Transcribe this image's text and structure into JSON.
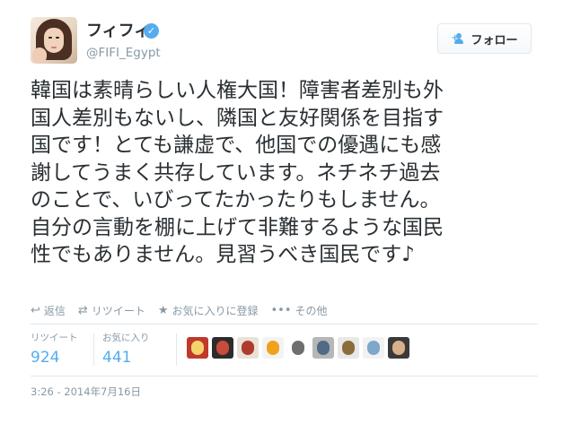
{
  "user": {
    "display_name": "フィフィ",
    "handle": "@FIFI_Egypt",
    "verified_glyph": "✓"
  },
  "follow_button": {
    "label": "フォロー"
  },
  "tweet": {
    "lines": [
      "韓国は素晴らしい人権大国！障害者差別も外",
      "国人差別もないし、隣国と友好関係を目指す",
      "国です！とても謙虚で、他国での優遇にも感",
      "謝してうまく共存しています。ネチネチ過去",
      "のことで、いびってたかったりもしません。",
      "自分の言動を棚に上げて非難するような国民",
      "性でもありません。見習うべき国民です♪"
    ]
  },
  "actions": {
    "reply": "返信",
    "retweet": "リツイート",
    "favorite": "お気に入りに登録",
    "more": "その他"
  },
  "stats": {
    "retweets_label": "リツイート",
    "retweets_value": "924",
    "favorites_label": "お気に入り",
    "favorites_value": "441"
  },
  "favoriter_avatars": [
    {
      "bg": "#c0392b",
      "fg": "#f5d36b"
    },
    {
      "bg": "#2c2c2c",
      "fg": "#c94b3b"
    },
    {
      "bg": "#e9e2d8",
      "fg": "#b03a2e"
    },
    {
      "bg": "#f3f3f3",
      "fg": "#f0a21b"
    },
    {
      "bg": "#ffffff",
      "fg": "#6e6e6e"
    },
    {
      "bg": "#b7b7b7",
      "fg": "#4f6b87"
    },
    {
      "bg": "#e8e8e8",
      "fg": "#8a6d3b"
    },
    {
      "bg": "#f2f2f2",
      "fg": "#7fa7c9"
    },
    {
      "bg": "#3a3a3a",
      "fg": "#d9b08c"
    }
  ],
  "timestamp": "3:26 - 2014年7月16日",
  "colors": {
    "accent": "#55acee",
    "muted": "#8899a6",
    "text": "#292f33",
    "divider": "#e1e8ed"
  }
}
